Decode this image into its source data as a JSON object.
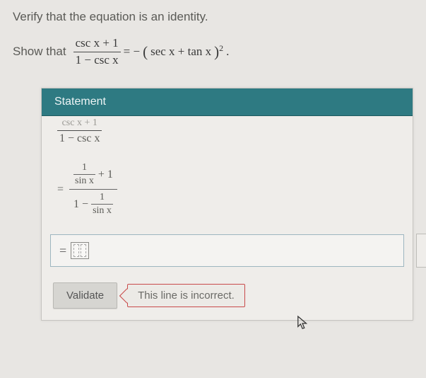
{
  "instruction": "Verify that the equation is an identity.",
  "show_that_label": "Show that",
  "equation": {
    "lhs_num": "csc x + 1",
    "lhs_den": "1 − csc x",
    "eq": "= −",
    "rhs_base_open": "(",
    "rhs_base": "sec x + tan x",
    "rhs_base_close": ")",
    "rhs_exp": "2",
    "period": "."
  },
  "panel": {
    "header": "Statement",
    "step1": {
      "num": "csc x + 1",
      "den": "1 − csc x"
    },
    "step2": {
      "eq": "=",
      "top_frac_n": "1",
      "top_frac_d": "sin x",
      "top_plus": "+ 1",
      "bot_lead": "1 −",
      "bot_frac_n": "1",
      "bot_frac_d": "sin x"
    },
    "input": {
      "prefix": "="
    },
    "validate_label": "Validate",
    "error_text": "This line is incorrect."
  }
}
